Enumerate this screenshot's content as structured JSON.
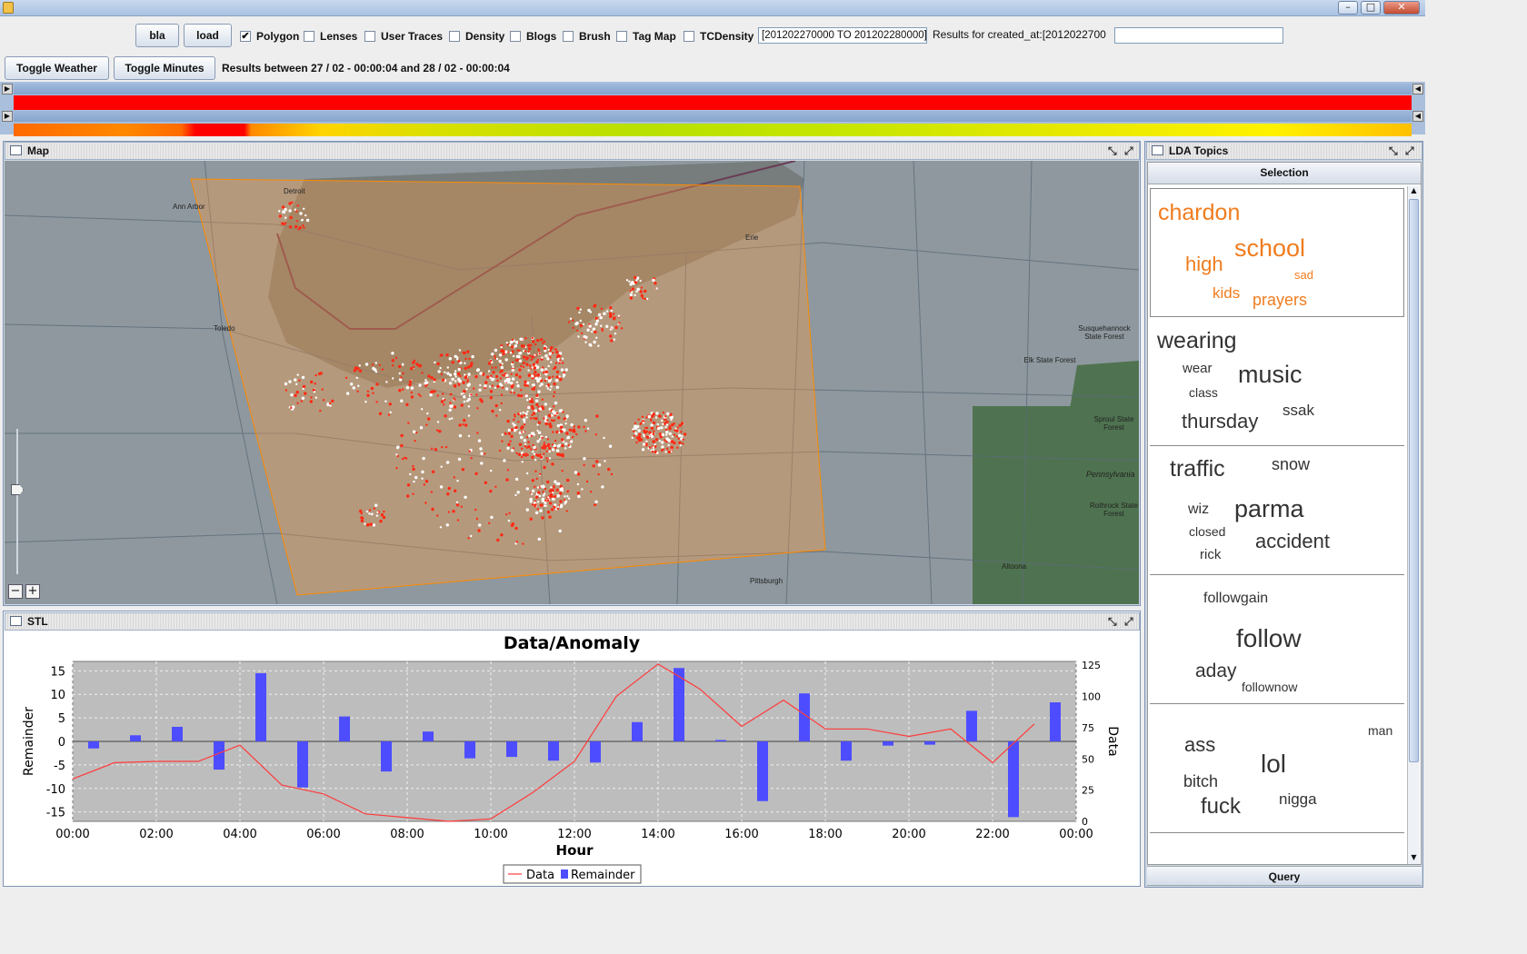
{
  "window": {
    "min_label": "–",
    "max_label": "□",
    "close_label": "✕"
  },
  "toolbar": {
    "bla_label": "bla",
    "load_label": "load",
    "checkboxes": [
      {
        "label": "Polygon",
        "checked": true
      },
      {
        "label": "Lenses",
        "checked": false
      },
      {
        "label": "User Traces",
        "checked": false
      },
      {
        "label": "Density",
        "checked": false
      },
      {
        "label": "Blogs",
        "checked": false
      },
      {
        "label": "Brush",
        "checked": false
      },
      {
        "label": "Tag Map",
        "checked": false
      },
      {
        "label": "TCDensity",
        "checked": false
      }
    ],
    "query_value": "[201202270000 TO 201202280000]",
    "results_for_text": "Results for  created_at:[2012022700",
    "search_value": ""
  },
  "toolbar2": {
    "toggle_weather_label": "Toggle Weather",
    "toggle_minutes_label": "Toggle Minutes",
    "results_between_text": "Results between  27 / 02 - 00:00:04  and  28 / 02 - 00:00:04"
  },
  "map_panel": {
    "title": "Map",
    "cities": [
      "Detroit",
      "Ann Arbor",
      "Toledo",
      "Erie",
      "Pittsburgh",
      "Altoona",
      "Susquehannock State Forest",
      "Elk State Forest",
      "Sproul State Forest",
      "Rothrock State Forest",
      "Pennsylvania"
    ],
    "zoom_out_label": "−",
    "zoom_in_label": "+"
  },
  "stl_panel": {
    "title": "STL"
  },
  "topics_panel": {
    "title": "LDA Topics",
    "selection_label": "Selection",
    "query_label": "Query",
    "topics": [
      {
        "words": [
          "chardon",
          "high",
          "school",
          "sad",
          "kids",
          "prayers"
        ],
        "color": "#f07c1e"
      },
      {
        "words": [
          "wearing",
          "wear",
          "music",
          "class",
          "ssak",
          "thursday"
        ],
        "color": "#333333"
      },
      {
        "words": [
          "traffic",
          "snow",
          "wiz",
          "parma",
          "closed",
          "accident",
          "rick"
        ],
        "color": "#333333"
      },
      {
        "words": [
          "followgain",
          "follow",
          "aday",
          "follownow"
        ],
        "color": "#333333"
      },
      {
        "words": [
          "man",
          "ass",
          "lol",
          "bitch",
          "nigga",
          "fuck"
        ],
        "color": "#333333"
      }
    ]
  },
  "chart_data": {
    "type": "bar",
    "title": "Data/Anomaly",
    "xlabel": "Hour",
    "ylabel": "Remainder",
    "y2label": "Data",
    "xticks": [
      "00:00",
      "02:00",
      "04:00",
      "06:00",
      "08:00",
      "10:00",
      "12:00",
      "14:00",
      "16:00",
      "18:00",
      "20:00",
      "22:00",
      "00:00"
    ],
    "yticks": [
      "15",
      "10",
      "5",
      "0",
      "-5",
      "-10",
      "-15"
    ],
    "y2ticks": [
      "125",
      "100",
      "75",
      "50",
      "25",
      "0"
    ],
    "ylim": [
      -17,
      17
    ],
    "y2lim": [
      0,
      128
    ],
    "hours": [
      0.5,
      1.5,
      2.5,
      3.5,
      4.5,
      5.5,
      6.5,
      7.5,
      8.5,
      9.5,
      10.5,
      11.5,
      12.5,
      13.5,
      14.5,
      15.5,
      16.5,
      17.5,
      18.5,
      19.5,
      20.5,
      21.5,
      22.5,
      23.5
    ],
    "series": [
      {
        "name": "Remainder",
        "type": "bar",
        "color": "#4d4dff",
        "values": [
          -1.5,
          1.3,
          3.1,
          -6,
          14.5,
          -9.8,
          5.3,
          -6.4,
          2.1,
          -3.6,
          -3.3,
          -4.1,
          -4.5,
          4.1,
          15.6,
          0.3,
          -12.7,
          10.2,
          -4.1,
          -0.9,
          -0.7,
          6.5,
          -16.1,
          8.3
        ]
      },
      {
        "name": "Data",
        "type": "line",
        "color": "#ff3b3b",
        "x": [
          0,
          1,
          2,
          3,
          4,
          5,
          6,
          7,
          8,
          9,
          10,
          11,
          12,
          13,
          14,
          15,
          16,
          17,
          18,
          19,
          20,
          21,
          22,
          23
        ],
        "values": [
          34,
          47,
          48,
          48,
          61,
          29,
          22,
          6,
          3,
          0,
          2,
          23,
          48,
          100,
          126,
          106,
          76,
          97,
          74,
          74,
          68,
          74,
          47,
          78
        ]
      }
    ],
    "legend": [
      "Data",
      "Remainder"
    ],
    "legend_position": "bottom-center",
    "grid": true
  }
}
